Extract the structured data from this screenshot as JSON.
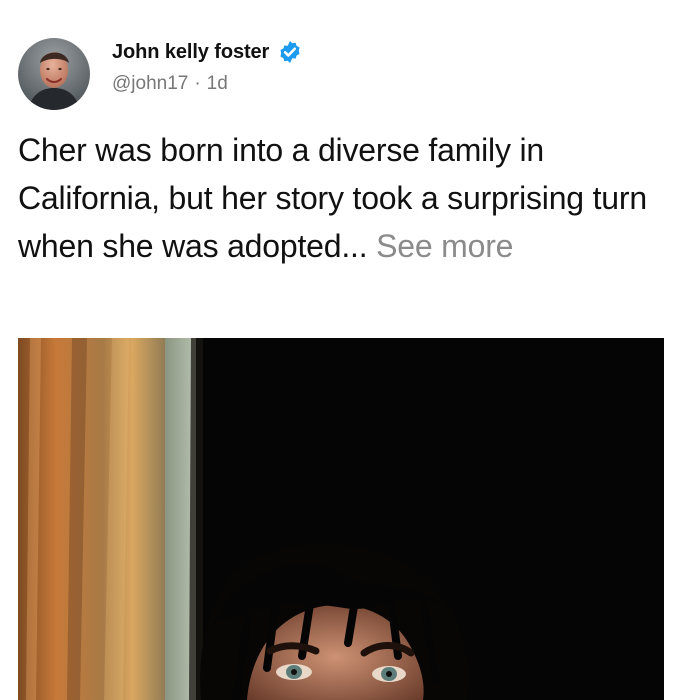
{
  "post": {
    "author_name": "John kelly foster",
    "handle": "@john17",
    "separator": "·",
    "time": "1d",
    "text_main": "Cher was born into a diverse family in California, but her story took a surprising turn when she was adopted...",
    "see_more": "See more"
  },
  "icons": {
    "verified": "verified-badge-icon",
    "avatar": "profile-avatar"
  },
  "colors": {
    "verified_blue": "#1d9bf0",
    "primary_text": "#111111",
    "secondary_text": "#777777",
    "see_more_text": "#8b8b8b"
  }
}
